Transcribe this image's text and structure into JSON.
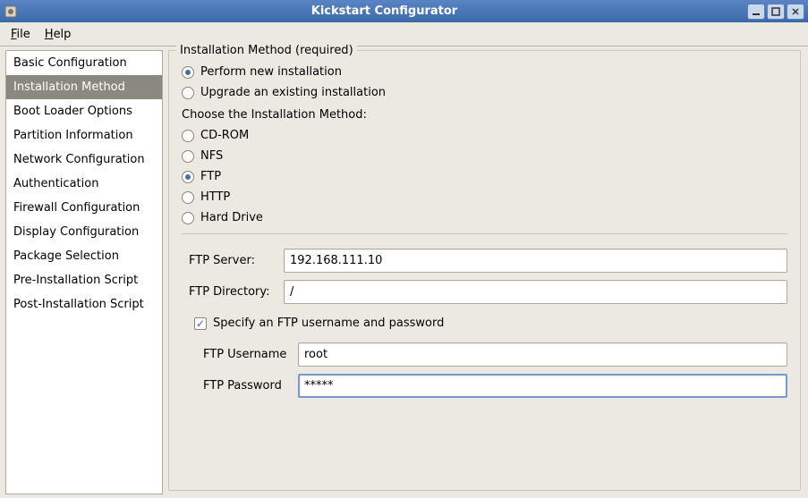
{
  "window": {
    "title": "Kickstart Configurator"
  },
  "menubar": {
    "file": "File",
    "help": "Help"
  },
  "sidebar": {
    "items": [
      {
        "label": "Basic Configuration"
      },
      {
        "label": "Installation Method"
      },
      {
        "label": "Boot Loader Options"
      },
      {
        "label": "Partition Information"
      },
      {
        "label": "Network Configuration"
      },
      {
        "label": "Authentication"
      },
      {
        "label": "Firewall Configuration"
      },
      {
        "label": "Display Configuration"
      },
      {
        "label": "Package Selection"
      },
      {
        "label": "Pre-Installation Script"
      },
      {
        "label": "Post-Installation Script"
      }
    ],
    "selected_index": 1
  },
  "main": {
    "group_title": "Installation Method (required)",
    "install_type": {
      "perform_new": "Perform new installation",
      "upgrade": "Upgrade an existing installation",
      "selected": "perform_new"
    },
    "choose_method_label": "Choose the Installation Method:",
    "methods": {
      "cdrom": "CD-ROM",
      "nfs": "NFS",
      "ftp": "FTP",
      "http": "HTTP",
      "harddrive": "Hard Drive",
      "selected": "ftp"
    },
    "ftp": {
      "server_label": "FTP Server:",
      "server_value": "192.168.111.10",
      "dir_label": "FTP Directory:",
      "dir_value": "/",
      "specify_cred_label": "Specify an FTP username and password",
      "specify_cred_checked": true,
      "username_label": "FTP Username",
      "username_value": "root",
      "password_label": "FTP Password",
      "password_value": "*****"
    }
  }
}
